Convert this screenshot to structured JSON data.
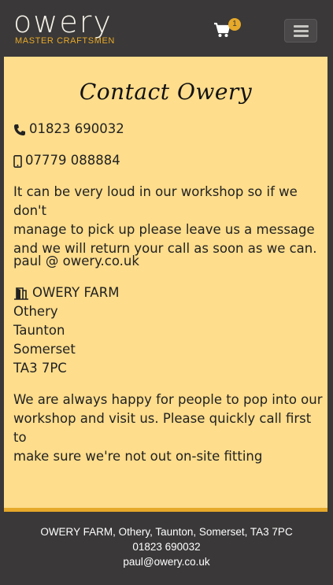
{
  "header": {
    "logo_word": "owery",
    "logo_tagline": "MASTER CRAFTSMEN",
    "cart_count": "1",
    "icons": {
      "cart": "cart-icon",
      "menu": "hamburger-menu-icon"
    },
    "colors": {
      "bar": "#3a3838",
      "accent": "#e7a92a"
    }
  },
  "contact": {
    "title": "Contact Owery",
    "phone": "01823 690032",
    "mobile": "07779 088884",
    "loud_note": [
      "It can be very loud in our workshop so if we don't",
      "manage to pick up please leave us a message",
      "and we will return your call as soon as we can."
    ],
    "email": "paul @ owery.co.uk",
    "address": [
      "OWERY FARM",
      "Othery",
      "Taunton",
      "Somerset",
      "TA3 7PC"
    ],
    "visit_note": [
      "We are always happy for people to pop into our",
      "workshop and visit us. Please quickly call first to",
      "make sure we're not out on-site fitting"
    ],
    "icons": {
      "phone": "phone-icon",
      "mobile": "mobile-phone-icon",
      "address": "door-open-icon"
    },
    "colors": {
      "panel": "#fedd8c"
    }
  },
  "footer": {
    "address": "OWERY FARM, Othery, Taunton, Somerset, TA3 7PC",
    "phone": "01823 690032",
    "email": "paul@owery.co.uk"
  }
}
